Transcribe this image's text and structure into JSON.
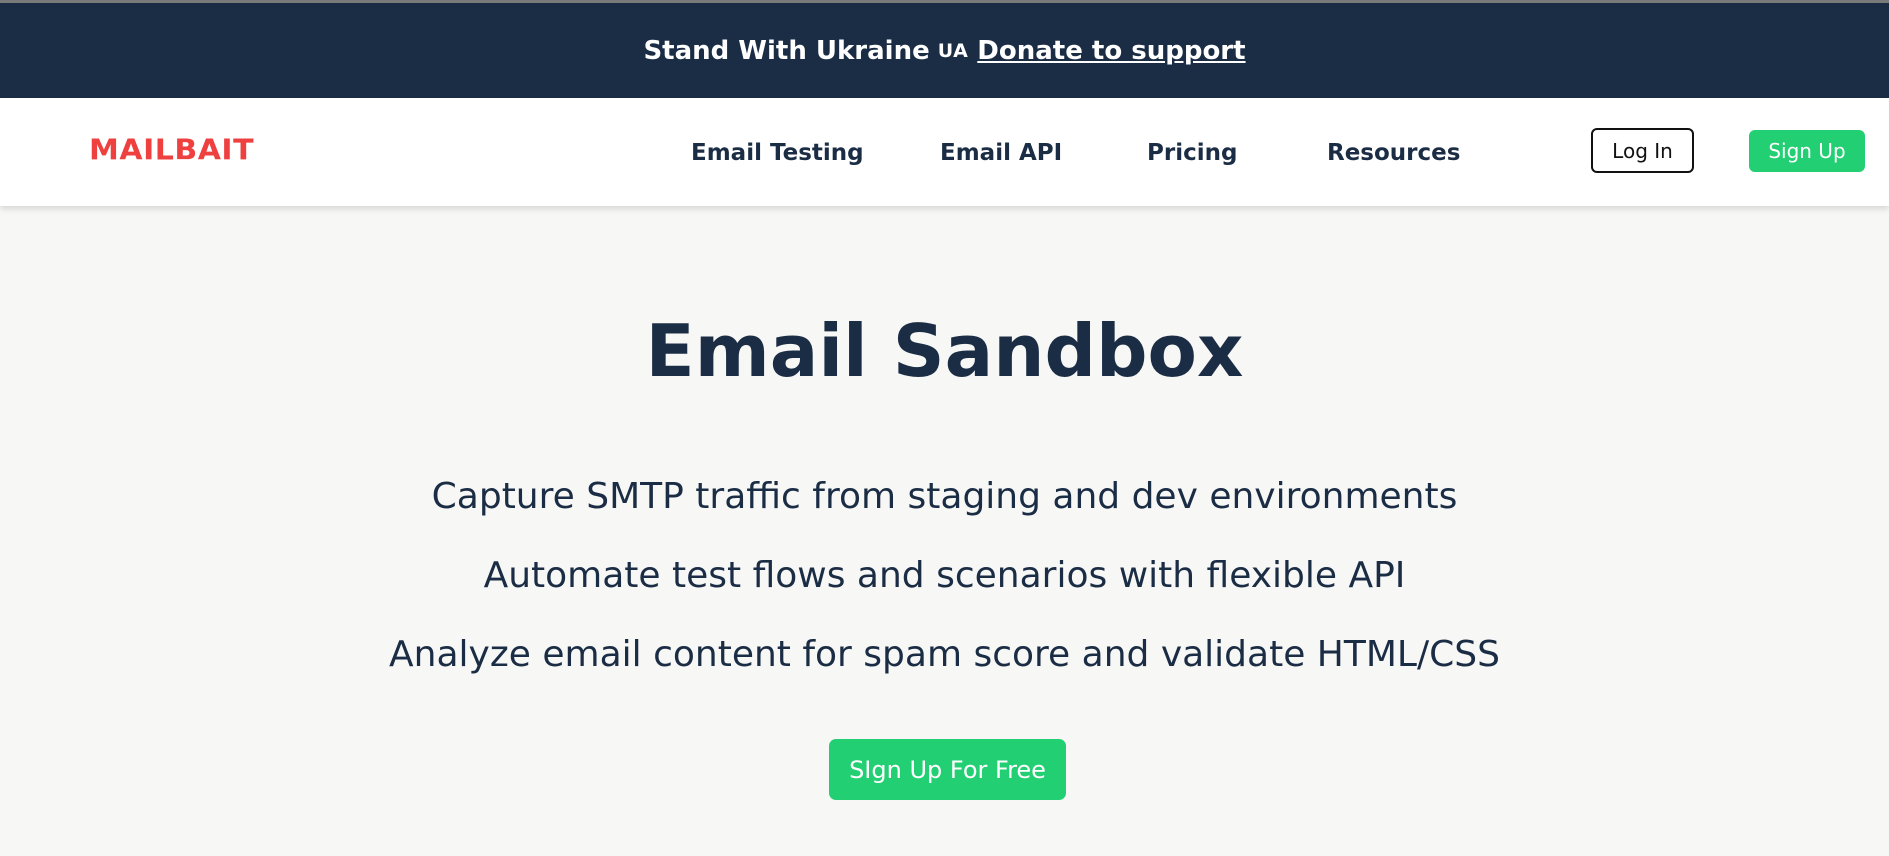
{
  "banner": {
    "text": "Stand With Ukraine",
    "flag": "UA",
    "link_label": "Donate to support"
  },
  "header": {
    "logo": "MAILBAIT",
    "nav": [
      {
        "label": "Email Testing"
      },
      {
        "label": "Email API"
      },
      {
        "label": "Pricing"
      },
      {
        "label": "Resources"
      }
    ],
    "login_label": "Log In",
    "signup_label": "Sign Up"
  },
  "hero": {
    "title": "Email Sandbox",
    "features": [
      "Capture SMTP traffic from staging and dev environments",
      "Automate test flows and scenarios with flexible API",
      "Analyze email content for spam score and validate HTML/CSS"
    ],
    "cta_label": "SIgn Up For Free"
  },
  "colors": {
    "banner_bg": "#1b2d45",
    "logo": "#ef4040",
    "accent_green": "#22cf73",
    "page_bg": "#f7f7f5",
    "text": "#1b2d45"
  }
}
